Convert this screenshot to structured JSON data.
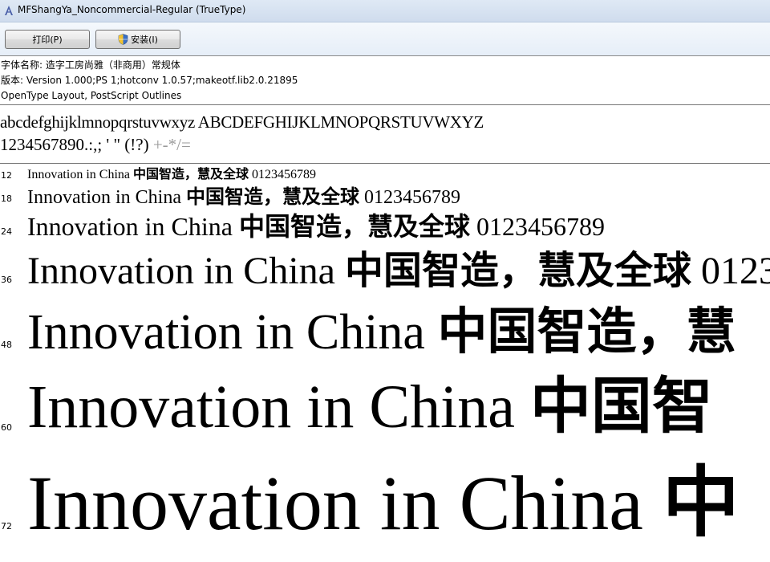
{
  "window": {
    "title": "MFShangYa_Noncommercial-Regular (TrueType)"
  },
  "toolbar": {
    "print_label": "打印(P)",
    "install_label": "安装(I)"
  },
  "info": {
    "font_name": "字体名称: 造字工房尚雅（非商用）常规体",
    "version": "版本: Version 1.000;PS 1;hotconv 1.0.57;makeotf.lib2.0.21895",
    "format": "OpenType Layout, PostScript Outlines"
  },
  "charset": {
    "letters": "abcdefghijklmnopqrstuvwxyz ABCDEFGHIJKLMNOPQRSTUVWXYZ",
    "digits": "1234567890.:,; ' \" (!?)",
    "symbols": " +-*/="
  },
  "samples": [
    {
      "size": "12",
      "latin": "Innovation in China ",
      "cjk": "中国智造，慧及全球",
      "digits": " 0123456789"
    },
    {
      "size": "18",
      "latin": "Innovation in China ",
      "cjk": "中国智造，慧及全球",
      "digits": " 0123456789"
    },
    {
      "size": "24",
      "latin": "Innovation in China ",
      "cjk": "中国智造，慧及全球",
      "digits": " 0123456789"
    },
    {
      "size": "36",
      "latin": "Innovation in China ",
      "cjk": "中国智造，慧及全球",
      "digits": " 0123"
    },
    {
      "size": "48",
      "latin": "Innovation in China ",
      "cjk": "中国智造，慧",
      "digits": ""
    },
    {
      "size": "60",
      "latin": "Innovation in China ",
      "cjk": "中国智",
      "digits": ""
    },
    {
      "size": "72",
      "latin": "Innovation in China ",
      "cjk": "中",
      "digits": ""
    }
  ]
}
